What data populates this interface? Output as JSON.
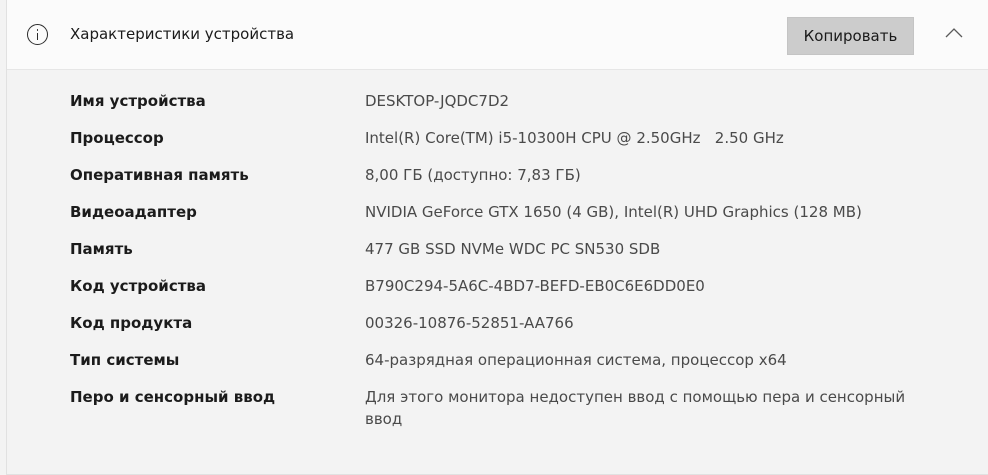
{
  "header": {
    "title": "Характеристики устройства",
    "copy_label": "Копировать",
    "info_icon": "info-icon",
    "collapse_icon": "chevron-up-icon"
  },
  "specs": [
    {
      "label": "Имя устройства",
      "value": "DESKTOP-JQDC7D2"
    },
    {
      "label": "Процессор",
      "value": "Intel(R) Core(TM) i5-10300H CPU @ 2.50GHz   2.50 GHz"
    },
    {
      "label": "Оперативная память",
      "value": "8,00 ГБ (доступно: 7,83 ГБ)"
    },
    {
      "label": "Видеоадаптер",
      "value": "NVIDIA GeForce GTX 1650 (4 GB), Intel(R) UHD Graphics (128 MB)"
    },
    {
      "label": "Память",
      "value": "477 GB SSD NVMe WDC PC SN530 SDB"
    },
    {
      "label": "Код устройства",
      "value": "B790C294-5A6C-4BD7-BEFD-EB0C6E6DD0E0"
    },
    {
      "label": "Код продукта",
      "value": "00326-10876-52851-AA766"
    },
    {
      "label": "Тип системы",
      "value": "64-разрядная операционная система, процессор x64"
    },
    {
      "label": "Перо и сенсорный ввод",
      "value": "Для этого монитора недоступен ввод с помощью пера и сенсорный ввод"
    }
  ]
}
